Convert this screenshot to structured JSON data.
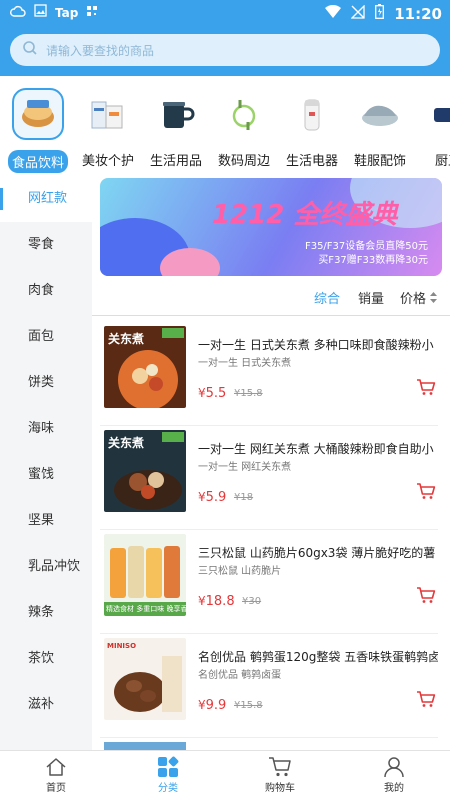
{
  "status_bar": {
    "time": "11:20",
    "app_badge": "Tap"
  },
  "search": {
    "placeholder": "请输入要查找的商品"
  },
  "categories": [
    {
      "label": "食品饮料",
      "icon": "snack-icon",
      "active": true
    },
    {
      "label": "美妆个护",
      "icon": "cosmetics-icon",
      "active": false
    },
    {
      "label": "生活用品",
      "icon": "mug-icon",
      "active": false
    },
    {
      "label": "数码周边",
      "icon": "cable-icon",
      "active": false
    },
    {
      "label": "生活电器",
      "icon": "thermos-icon",
      "active": false
    },
    {
      "label": "鞋服配饰",
      "icon": "slipper-icon",
      "active": false
    },
    {
      "label": "厨卫",
      "icon": "kitchen-icon",
      "active": false
    }
  ],
  "sidebar": {
    "items": [
      "网红款",
      "零食",
      "肉食",
      "面包",
      "饼类",
      "海味",
      "蜜饯",
      "坚果",
      "乳品冲饮",
      "辣条",
      "茶饮",
      "滋补"
    ],
    "active": "网红款"
  },
  "banner": {
    "title": "1212 全终盛典",
    "line1": "F35/F37设备会员直降50元",
    "line2": "买F37赠F33数再降30元"
  },
  "sort": {
    "comprehensive": "综合",
    "sales": "销量",
    "price": "价格"
  },
  "products": [
    {
      "title": "一对一生 日式关东煮 多种口味即食酸辣粉小",
      "subtitle": "一对一生 日式关东煮",
      "price": "5.5",
      "original_price": "15.8",
      "currency": "¥",
      "img_text": "关东煮"
    },
    {
      "title": "一对一生 网红关东煮 大桶酸辣粉即食自助小",
      "subtitle": "一对一生 网红关东煮",
      "price": "5.9",
      "original_price": "18",
      "currency": "¥",
      "img_text": "关东煮"
    },
    {
      "title": "三只松鼠 山药脆片60gx3袋 薄片脆好吃的薯",
      "subtitle": "三只松鼠 山药脆片",
      "price": "18.8",
      "original_price": "30",
      "currency": "¥",
      "img_text": "精选食材 多重口味 晚享香脆"
    },
    {
      "title": "名创优品 鹌鹑蛋120g整袋 五香味铁蛋鹌鹑卤",
      "subtitle": "名创优品 鹌鹑卤蛋",
      "price": "9.9",
      "original_price": "15.8",
      "currency": "¥",
      "img_text": "MINISO"
    }
  ],
  "bottom_nav": [
    {
      "label": "首页",
      "icon": "home-icon",
      "active": false
    },
    {
      "label": "分类",
      "icon": "category-icon",
      "active": true
    },
    {
      "label": "购物车",
      "icon": "cart-icon",
      "active": false
    },
    {
      "label": "我的",
      "icon": "profile-icon",
      "active": false
    }
  ],
  "colors": {
    "accent": "#3aa2ea",
    "price": "#e4383a",
    "sidebar_bg": "#f4f5f7"
  }
}
